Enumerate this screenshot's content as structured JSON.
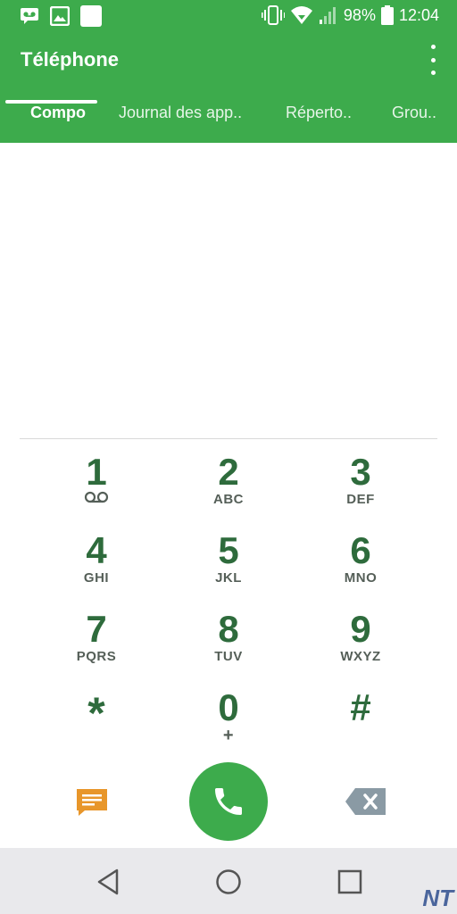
{
  "status_bar": {
    "icons_left": [
      "voicemail-icon",
      "image-icon",
      "blank-icon"
    ],
    "icons_right": [
      "vibrate-icon",
      "wifi-icon",
      "signal-icon"
    ],
    "battery": "98%",
    "time": "12:04"
  },
  "app": {
    "title": "Téléphone"
  },
  "tabs": [
    {
      "label": "Compo",
      "active": true
    },
    {
      "label": "Journal des app..",
      "active": false
    },
    {
      "label": "Réperto..",
      "active": false
    },
    {
      "label": "Grou..",
      "active": false
    }
  ],
  "keypad": [
    {
      "digit": "1",
      "letters": ""
    },
    {
      "digit": "2",
      "letters": "ABC"
    },
    {
      "digit": "3",
      "letters": "DEF"
    },
    {
      "digit": "4",
      "letters": "GHI"
    },
    {
      "digit": "5",
      "letters": "JKL"
    },
    {
      "digit": "6",
      "letters": "MNO"
    },
    {
      "digit": "7",
      "letters": "PQRS"
    },
    {
      "digit": "8",
      "letters": "TUV"
    },
    {
      "digit": "9",
      "letters": "WXYZ"
    },
    {
      "digit": "*",
      "letters": ""
    },
    {
      "digit": "0",
      "letters": "+"
    },
    {
      "digit": "#",
      "letters": ""
    }
  ],
  "actions": {
    "message_icon": "message-icon",
    "call_icon": "phone-icon",
    "backspace_icon": "backspace-icon"
  },
  "colors": {
    "primary": "#3dab4c",
    "key_text": "#2e6b3c",
    "message_orange": "#e8962a",
    "backspace_gray": "#8a9aa4"
  },
  "watermark": "NT"
}
